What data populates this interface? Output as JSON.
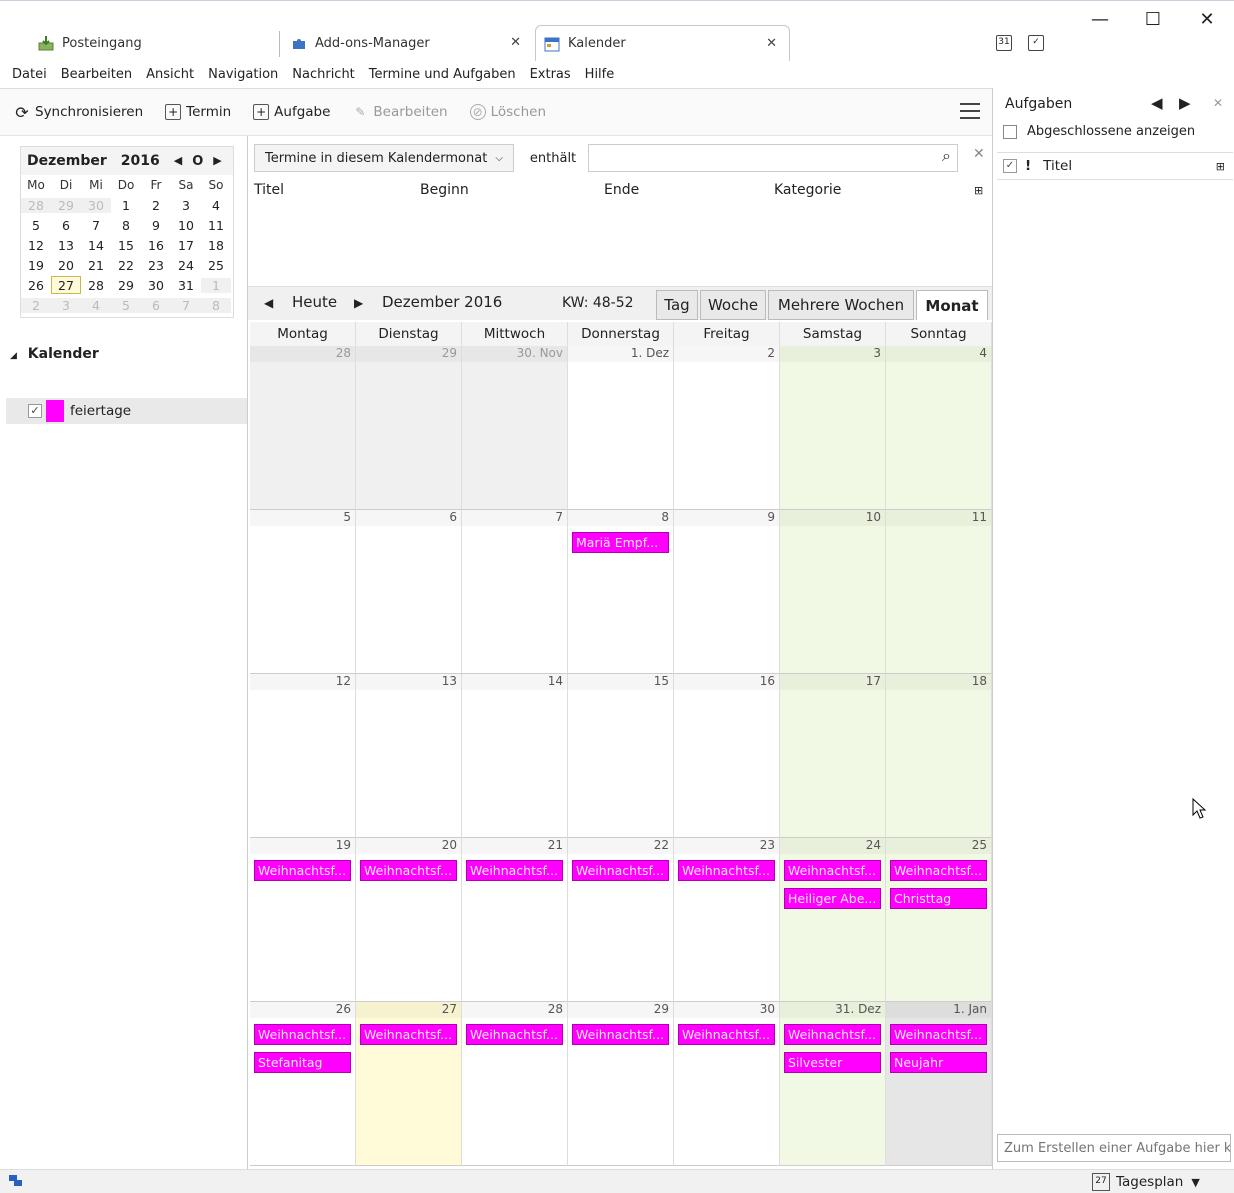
{
  "tabs": [
    {
      "label": "Posteingang",
      "closable": false
    },
    {
      "label": "Add-ons-Manager",
      "closable": true
    },
    {
      "label": "Kalender",
      "closable": true,
      "active": true
    }
  ],
  "window_controls": {
    "minimize": "—",
    "maximize": "☐",
    "close": "✕"
  },
  "menu": [
    "Datei",
    "Bearbeiten",
    "Ansicht",
    "Navigation",
    "Nachricht",
    "Termine und Aufgaben",
    "Extras",
    "Hilfe"
  ],
  "toolbar": {
    "sync": "Synchronisieren",
    "event": "Termin",
    "task": "Aufgabe",
    "edit": "Bearbeiten",
    "delete": "Löschen"
  },
  "minimonth": {
    "month": "Dezember",
    "year": "2016",
    "weekdays": [
      "Mo",
      "Di",
      "Mi",
      "Do",
      "Fr",
      "Sa",
      "So"
    ],
    "weeks": [
      [
        "28",
        "29",
        "30",
        "1",
        "2",
        "3",
        "4"
      ],
      [
        "5",
        "6",
        "7",
        "8",
        "9",
        "10",
        "11"
      ],
      [
        "12",
        "13",
        "14",
        "15",
        "16",
        "17",
        "18"
      ],
      [
        "19",
        "20",
        "21",
        "22",
        "23",
        "24",
        "25"
      ],
      [
        "26",
        "27",
        "28",
        "29",
        "30",
        "31",
        "1"
      ],
      [
        "2",
        "3",
        "4",
        "5",
        "6",
        "7",
        "8"
      ]
    ],
    "today": "27"
  },
  "calendars": {
    "header": "Kalender",
    "items": [
      {
        "name": "feiertage",
        "color": "#ff00ff",
        "checked": true
      }
    ]
  },
  "filter": {
    "selected": "Termine in diesem Kalendermonat",
    "label": "enthält",
    "value": ""
  },
  "event_list_columns": [
    "Titel",
    "Beginn",
    "Ende",
    "Kategorie"
  ],
  "view_nav": {
    "today": "Heute",
    "period": "Dezember 2016",
    "week_range": "KW: 48-52",
    "views": [
      "Tag",
      "Woche",
      "Mehrere Wochen",
      "Monat"
    ],
    "active_view": "Monat"
  },
  "month_view": {
    "day_headers": [
      "Montag",
      "Dienstag",
      "Mittwoch",
      "Donnerstag",
      "Freitag",
      "Samstag",
      "Sonntag"
    ],
    "weeks": [
      {
        "days": [
          {
            "label": "28",
            "type": "other",
            "events": []
          },
          {
            "label": "29",
            "type": "other",
            "events": []
          },
          {
            "label": "30. Nov",
            "type": "other",
            "events": []
          },
          {
            "label": "1. Dez",
            "type": "",
            "events": []
          },
          {
            "label": "2",
            "type": "",
            "events": []
          },
          {
            "label": "3",
            "type": "weekend",
            "events": []
          },
          {
            "label": "4",
            "type": "weekend",
            "events": []
          }
        ]
      },
      {
        "days": [
          {
            "label": "5",
            "type": "",
            "events": []
          },
          {
            "label": "6",
            "type": "",
            "events": []
          },
          {
            "label": "7",
            "type": "",
            "events": []
          },
          {
            "label": "8",
            "type": "",
            "events": [
              "Mariä Empf..."
            ]
          },
          {
            "label": "9",
            "type": "",
            "events": []
          },
          {
            "label": "10",
            "type": "weekend",
            "events": []
          },
          {
            "label": "11",
            "type": "weekend",
            "events": []
          }
        ]
      },
      {
        "days": [
          {
            "label": "12",
            "type": "",
            "events": []
          },
          {
            "label": "13",
            "type": "",
            "events": []
          },
          {
            "label": "14",
            "type": "",
            "events": []
          },
          {
            "label": "15",
            "type": "",
            "events": []
          },
          {
            "label": "16",
            "type": "",
            "events": []
          },
          {
            "label": "17",
            "type": "weekend",
            "events": []
          },
          {
            "label": "18",
            "type": "weekend",
            "events": []
          }
        ]
      },
      {
        "days": [
          {
            "label": "19",
            "type": "",
            "events": [
              "Weihnachtsf..."
            ]
          },
          {
            "label": "20",
            "type": "",
            "events": [
              "Weihnachtsf..."
            ]
          },
          {
            "label": "21",
            "type": "",
            "events": [
              "Weihnachtsf..."
            ]
          },
          {
            "label": "22",
            "type": "",
            "events": [
              "Weihnachtsf..."
            ]
          },
          {
            "label": "23",
            "type": "",
            "events": [
              "Weihnachtsf..."
            ]
          },
          {
            "label": "24",
            "type": "weekend",
            "events": [
              "Weihnachtsf...",
              "Heiliger Abe..."
            ]
          },
          {
            "label": "25",
            "type": "weekend",
            "events": [
              "Weihnachtsf...",
              "Christtag"
            ]
          }
        ]
      },
      {
        "days": [
          {
            "label": "26",
            "type": "",
            "events": [
              "Weihnachtsf...",
              "Stefanitag"
            ]
          },
          {
            "label": "27",
            "type": "today",
            "events": [
              "Weihnachtsf..."
            ]
          },
          {
            "label": "28",
            "type": "",
            "events": [
              "Weihnachtsf..."
            ]
          },
          {
            "label": "29",
            "type": "",
            "events": [
              "Weihnachtsf..."
            ]
          },
          {
            "label": "30",
            "type": "",
            "events": [
              "Weihnachtsf..."
            ]
          },
          {
            "label": "31. Dez",
            "type": "weekend",
            "events": [
              "Weihnachtsf...",
              "Silvester"
            ]
          },
          {
            "label": "1. Jan",
            "type": "nextmonth",
            "events": [
              "Weihnachtsf...",
              "Neujahr"
            ]
          }
        ]
      }
    ]
  },
  "tasks_pane": {
    "title": "Aufgaben",
    "show_completed": "Abgeschlossene anzeigen",
    "column": "Titel",
    "new_task_placeholder": "Zum Erstellen einer Aufgabe hier k"
  },
  "statusbar": {
    "today_pane": "Tagesplan",
    "today_icon_num": "27"
  },
  "colors": {
    "event": "#ff00ff",
    "weekend": "#f1f8e4",
    "today": "#fffbd8"
  }
}
